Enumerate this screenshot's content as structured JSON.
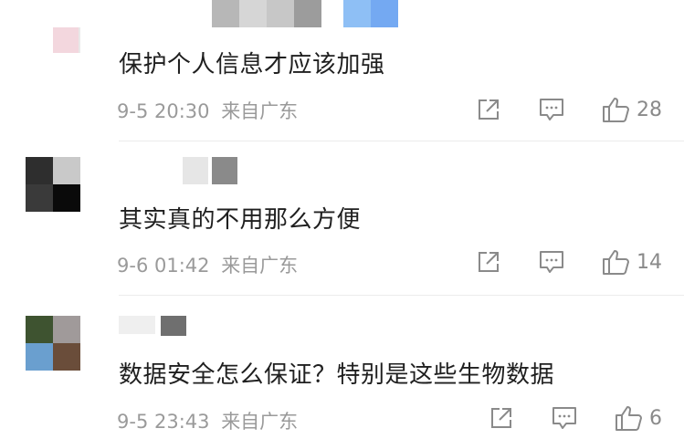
{
  "comments": [
    {
      "text": "保护个人信息才应该加强",
      "time": "9-5 20:30",
      "location": "来自广东",
      "likes": "28",
      "avatar_colors": [
        "#f3d7de",
        "#e9e9e9",
        "#ffffff",
        "#ffffff"
      ],
      "name_blocks": [
        "#b7b7b7",
        "#d6d6d6",
        "#9c9c9c",
        "#8ebff5",
        "#74a9f2"
      ]
    },
    {
      "text": "其实真的不用那么方便",
      "time": "9-6 01:42",
      "location": "来自广东",
      "likes": "14",
      "avatar_colors": [
        "#2e2e2e",
        "#c9c9c9",
        "#0a0a0a",
        "#3a3a3a"
      ],
      "name_blocks": [
        "#e6e6e6",
        "#8a8a8a"
      ]
    },
    {
      "text": "数据安全怎么保证？特别是这些生物数据",
      "time": "9-5 23:43",
      "location": "来自广东",
      "likes": "6",
      "avatar_colors": [
        "#3e5330",
        "#a09a9a",
        "#6a9fcf",
        "#6a4d3a"
      ],
      "name_blocks": [
        "#d9d9d9",
        "#6f6f6f"
      ]
    }
  ],
  "icons": {
    "share": "share-icon",
    "comment": "comment-icon",
    "like": "thumbs-up-icon"
  }
}
